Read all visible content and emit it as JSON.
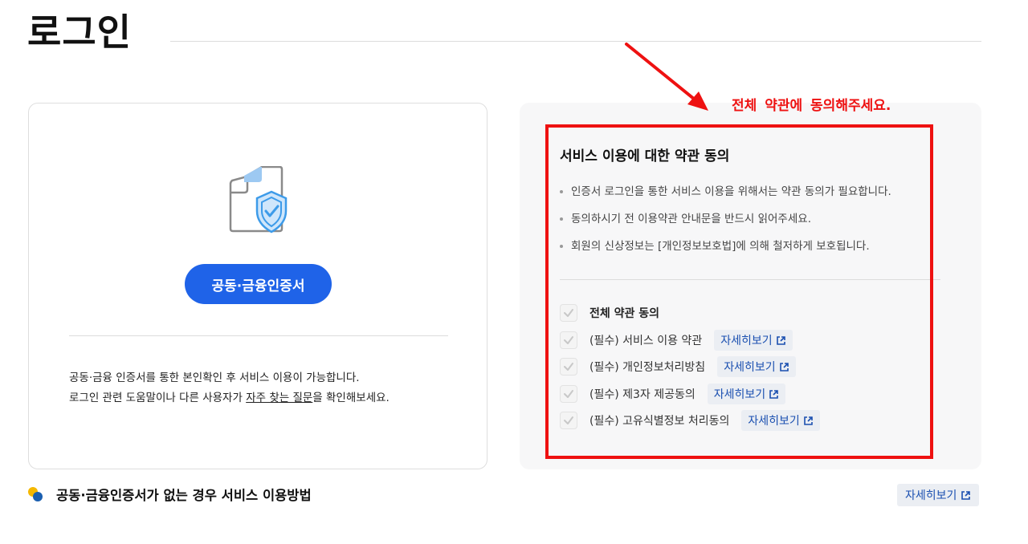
{
  "page": {
    "title": "로그인"
  },
  "cert_card": {
    "button_label": "공동·금융인증서",
    "desc_line1": "공동·금융 인증서를 통한 본인확인 후 서비스 이용이 가능합니다.",
    "desc_line2_prefix": "로그인 관련 도움말이나 다른 사용자가 ",
    "desc_line2_link": "자주 찾는 질문",
    "desc_line2_suffix": "을 확인해보세요."
  },
  "terms": {
    "heading": "서비스 이용에 대한 약관 동의",
    "notices": [
      "인증서 로그인을 통한 서비스 이용을 위해서는 약관 동의가 필요합니다.",
      "동의하시기 전 이용약관 안내문을 반드시 읽어주세요.",
      "회원의 신상정보는 [개인정보보호법]에 의해 철저하게 보호됩니다."
    ],
    "agree_all_label": "전체 약관 동의",
    "items": [
      {
        "label": "(필수) 서비스 이용 약관",
        "detail_label": "자세히보기"
      },
      {
        "label": "(필수) 개인정보처리방침",
        "detail_label": "자세히보기"
      },
      {
        "label": "(필수) 제3자 제공동의",
        "detail_label": "자세히보기"
      },
      {
        "label": "(필수) 고유식별정보 처리동의",
        "detail_label": "자세히보기"
      }
    ]
  },
  "annotation": {
    "text": "전체 약관에 동의해주세요.",
    "color": "#ee1111"
  },
  "bottom": {
    "heading": "공동·금융인증서가 없는 경우 서비스 이용방법",
    "detail_label": "자세히보기"
  },
  "colors": {
    "primary_button": "#1f63e8",
    "detail_text": "#1a4fb0",
    "detail_bg": "#ebeef3"
  },
  "icons": {
    "doc": "document-shield-icon",
    "check": "check-icon",
    "external": "external-link-icon",
    "bottom": "info-dots-icon"
  }
}
